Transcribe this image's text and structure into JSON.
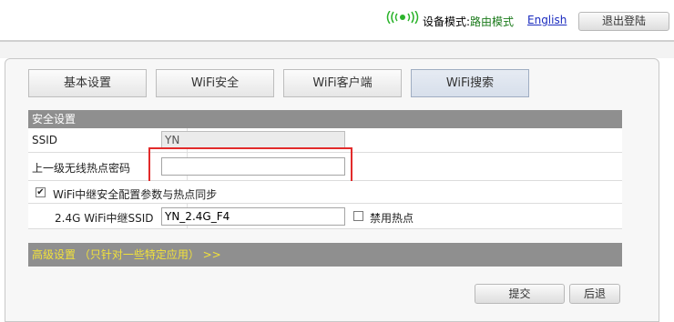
{
  "header": {
    "mode_label": "设备模式:",
    "mode_value": "路由模式",
    "language_link": "English",
    "logout_label": "退出登陆",
    "status_icon": "wifi-signal-icon",
    "status_icon_color": "#2bb32b"
  },
  "tabs": [
    {
      "label": "基本设置"
    },
    {
      "label": "WiFi安全"
    },
    {
      "label": "WiFi客户端"
    },
    {
      "label": "WiFi搜索",
      "active": true
    }
  ],
  "security": {
    "section_title": "安全设置",
    "ssid_label": "SSID",
    "ssid_value": "YN",
    "upper_password_label": "上一级无线热点密码",
    "upper_password_value": "",
    "sync_label": "WiFi中继安全配置参数与热点同步",
    "sync_checked": true,
    "repeater_ssid_label": "2.4G WiFi中继SSID",
    "repeater_ssid_value": "YN_2.4G_F4",
    "disable_hotspot_label": "禁用热点",
    "disable_hotspot_checked": false
  },
  "advanced": {
    "label": "高级设置 （只针对一些特定应用） >>"
  },
  "actions": {
    "submit_label": "提交",
    "back_label": "后退"
  },
  "colors": {
    "section_header_bg": "#8f8f8f",
    "advanced_text": "#f2e23a",
    "highlight_border": "#e22b2b"
  }
}
